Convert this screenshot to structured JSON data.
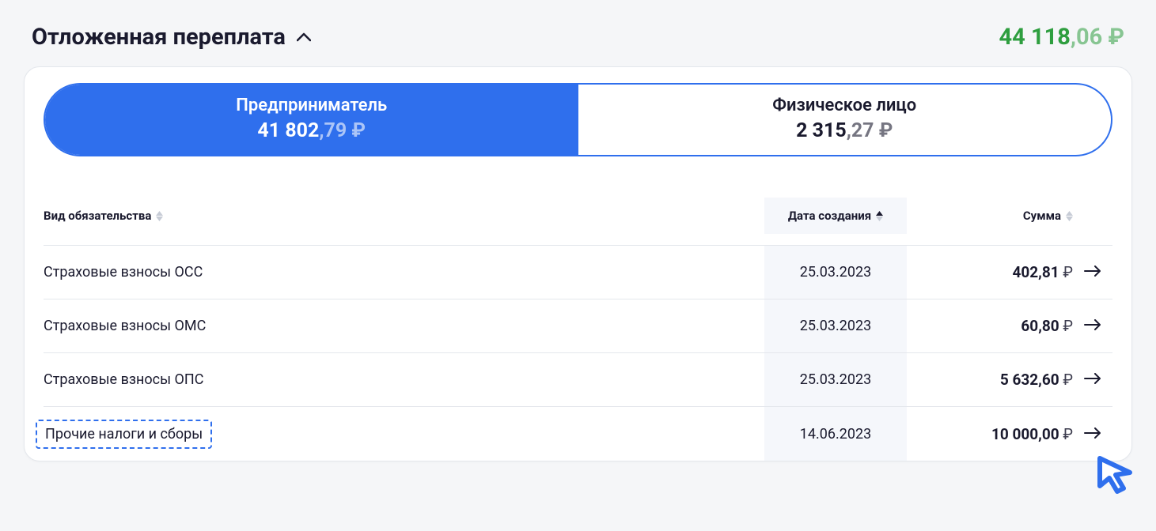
{
  "header": {
    "title": "Отложенная переплата",
    "total_int": "44 118",
    "total_dec": ",06",
    "total_rub": " ₽"
  },
  "tabs": [
    {
      "title": "Предприниматель",
      "amount_int": "41 802",
      "amount_dec": ",79",
      "rub": " ₽",
      "active": true
    },
    {
      "title": "Физическое лицо",
      "amount_int": "2 315",
      "amount_dec": ",27",
      "rub": " ₽",
      "active": false
    }
  ],
  "columns": {
    "obligation": "Вид обязательства",
    "date": "Дата создания",
    "sum": "Сумма"
  },
  "rows": [
    {
      "name": "Страховые взносы ОСС",
      "date": "25.03.2023",
      "sum": "402,81",
      "rub": " ₽"
    },
    {
      "name": "Страховые взносы ОМС",
      "date": "25.03.2023",
      "sum": "60,80",
      "rub": " ₽"
    },
    {
      "name": "Страховые взносы ОПС",
      "date": "25.03.2023",
      "sum": "5 632,60",
      "rub": " ₽"
    },
    {
      "name": "Прочие налоги и сборы",
      "date": "14.06.2023",
      "sum": "10 000,00",
      "rub": " ₽"
    }
  ]
}
